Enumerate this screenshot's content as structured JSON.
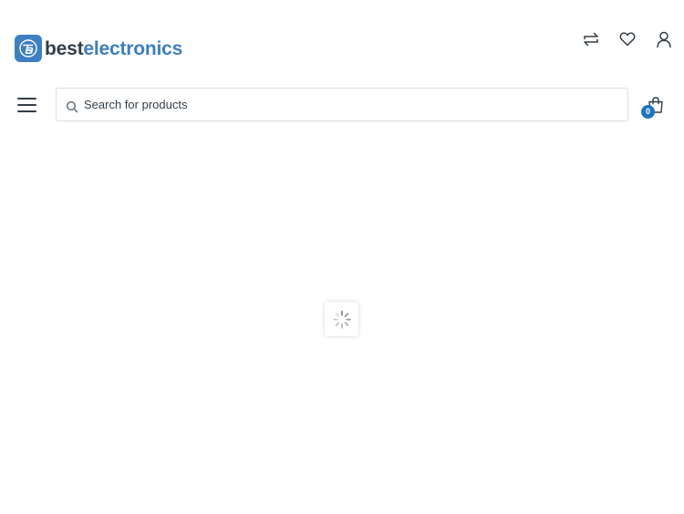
{
  "header": {
    "logo": {
      "brand_prefix": "best",
      "brand_suffix": "electronics",
      "brand_color": "#3d7fc2",
      "text_color": "#333e48",
      "icon": "logo-b-mark"
    },
    "icons": [
      {
        "name": "compare-icon",
        "icon": "two-way-arrows"
      },
      {
        "name": "wishlist-icon",
        "icon": "heart-outline"
      },
      {
        "name": "account-icon",
        "icon": "user-outline"
      }
    ]
  },
  "navbar": {
    "menu_icon": "hamburger-menu",
    "search": {
      "placeholder": "Search for products",
      "value": "",
      "icon": "search-icon"
    },
    "cart": {
      "icon": "shopping-bag",
      "count": "0",
      "badge_color": "#1e73be"
    }
  },
  "content": {
    "state": "loading",
    "spinner_icon": "spinner"
  }
}
